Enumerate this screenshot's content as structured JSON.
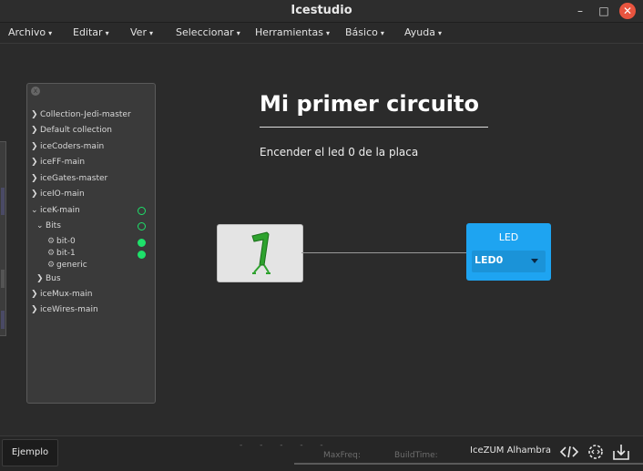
{
  "window": {
    "title": "Icestudio",
    "minimize": "–",
    "maximize": "□",
    "close": "✕"
  },
  "menu": {
    "items": [
      {
        "label": "Archivo"
      },
      {
        "label": "Editar"
      },
      {
        "label": "Ver"
      },
      {
        "label": "Seleccionar"
      },
      {
        "label": "Herramientas"
      },
      {
        "label": "Básico"
      },
      {
        "label": "Ayuda"
      }
    ],
    "caret": "▾"
  },
  "collections_panel": {
    "close": "x",
    "items": [
      {
        "label": "Collection-Jedi-master",
        "state": "collapsed"
      },
      {
        "label": "Default collection",
        "state": "collapsed"
      },
      {
        "label": "iceCoders-main",
        "state": "collapsed"
      },
      {
        "label": "iceFF-main",
        "state": "collapsed"
      },
      {
        "label": "iceGates-master",
        "state": "collapsed"
      },
      {
        "label": "iceIO-main",
        "state": "collapsed"
      },
      {
        "label": "iceK-main",
        "state": "expanded",
        "status": "ring"
      },
      {
        "label": "Bits",
        "state": "expanded",
        "status": "ring"
      },
      {
        "label": "bit-0",
        "state": "block",
        "status": "filled"
      },
      {
        "label": "bit-1",
        "state": "block",
        "status": "filled"
      },
      {
        "label": "generic",
        "state": "block"
      },
      {
        "label": "Bus",
        "state": "collapsed"
      },
      {
        "label": "iceMux-main",
        "state": "collapsed"
      },
      {
        "label": "iceWires-main",
        "state": "collapsed"
      }
    ]
  },
  "canvas": {
    "heading": "Mi primer circuito",
    "description": "Encender el led 0 de la placa",
    "constant_block": {
      "value": "1"
    },
    "led_block": {
      "title": "LED",
      "selected_pin": "LED0"
    }
  },
  "footer": {
    "example_button": "Ejemplo",
    "dashes": "- - - - -",
    "maxfreq_label": "MaxFreq:",
    "buildtime_label": "BuildTime:",
    "board": "IceZUM Alhambra",
    "icons": [
      "code-icon",
      "settings-code-icon",
      "upload-icon"
    ]
  },
  "colors": {
    "accent_blue": "#1ea4f1",
    "status_green": "#1ee06a",
    "close_red": "#e9543f"
  }
}
